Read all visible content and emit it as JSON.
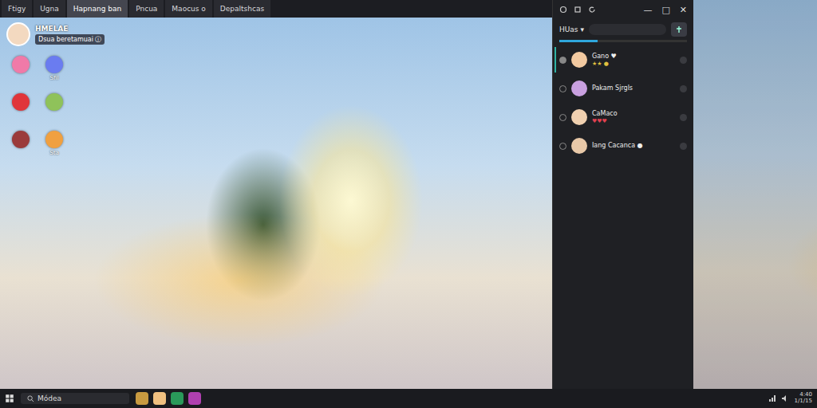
{
  "tabs": [
    {
      "label": "Ftigy",
      "selected": false
    },
    {
      "label": "Ugna",
      "selected": false
    },
    {
      "label": "Hapnang ban",
      "selected": true
    },
    {
      "label": "Pncua",
      "selected": false
    },
    {
      "label": "Maocus o",
      "selected": false
    },
    {
      "label": "Depaltshcas",
      "selected": false
    }
  ],
  "profile": {
    "name": "HMELAE",
    "status": "Dsua beretamuai ⓘ"
  },
  "desktop_icons": [
    {
      "label": "",
      "color": "#f07aa8"
    },
    {
      "label": "Sfil",
      "color": "#6a7cf0"
    },
    {
      "label": "",
      "color": "#e0353a"
    },
    {
      "label": "",
      "color": "#8fc25a"
    },
    {
      "label": "",
      "color": "#9b3b3b"
    },
    {
      "label": "Sta",
      "color": "#f0a040"
    }
  ],
  "window": {
    "controls": [
      "—",
      "□",
      "✕"
    ]
  },
  "chat": {
    "title": "HUas ▾",
    "search": {
      "placeholder": ""
    },
    "tab_level": 0.3,
    "contacts": [
      {
        "name": "Gano ♥",
        "sub": "★★ ●",
        "selected": true,
        "color": "#f2c9a0",
        "sub_color": "#e0c040"
      },
      {
        "name": "Pakam Sjrgls",
        "sub": "",
        "selected": false,
        "color": "#c9a0e0",
        "sub_color": "#30c0b0"
      },
      {
        "name": "CaMaco",
        "sub": "♥♥♥",
        "selected": false,
        "color": "#f0d0b0",
        "sub_color": "#e04050"
      },
      {
        "name": "Iang Cacanca ●",
        "sub": "",
        "selected": false,
        "color": "#e8c8a8",
        "sub_color": "#40c0a0"
      }
    ]
  },
  "taskbar": {
    "search": "Módea",
    "time": "4:40",
    "date": "1/1/15"
  }
}
